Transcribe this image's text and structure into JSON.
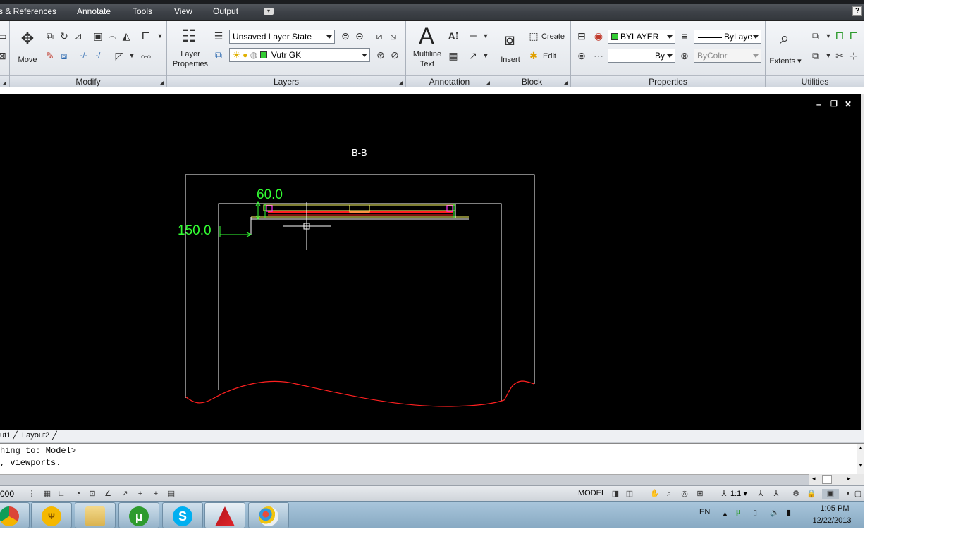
{
  "menubar": {
    "items": [
      "s & References",
      "Annotate",
      "Tools",
      "View",
      "Output"
    ],
    "help": "?"
  },
  "ribbon": {
    "panels": [
      "Modify",
      "Layers",
      "Annotation",
      "Block",
      "Properties",
      "Utilities"
    ],
    "modify": {
      "move_label": "Move"
    },
    "layers": {
      "layer_properties_label": "Layer Properties",
      "layer_state": "Unsaved Layer State",
      "current_layer": "Vutr GK"
    },
    "annotation": {
      "text_letter": "A",
      "multiline_label": "Multiline Text"
    },
    "block": {
      "insert_label": "Insert",
      "create_label": "Create",
      "edit_label": "Edit"
    },
    "properties": {
      "color": "BYLAYER",
      "lineweight": "ByLaye",
      "linetype": "By",
      "plotstyle": "ByColor"
    },
    "utilities": {
      "extents_label": "Extents"
    }
  },
  "drawing": {
    "section_label": "B-B",
    "dim_vertical": "60.0",
    "dim_horizontal": "150.0",
    "colors": {
      "background": "#000000",
      "lines": "#ffffff",
      "dimension": "#33ff33",
      "detail_red": "#ff2020",
      "detail_yellow": "#ffff66",
      "detail_magenta": "#ff33ff"
    }
  },
  "window_controls": {
    "minimize": "–",
    "restore": "❐",
    "close": "✕"
  },
  "layout_tabs": [
    "ut1",
    "Layout2"
  ],
  "command": {
    "line1": "hing to: Model>",
    "line2": ", viewports."
  },
  "statusbar": {
    "coords": "000",
    "model": "MODEL",
    "scale": "1:1"
  },
  "taskbar": {
    "apps": [
      "chrome-icon",
      "utorrent-old-icon",
      "file-explorer-icon",
      "utorrent-icon",
      "skype-icon",
      "autocad-icon",
      "paint-icon"
    ],
    "language": "EN",
    "time": "1:05 PM",
    "date": "12/22/2013"
  }
}
